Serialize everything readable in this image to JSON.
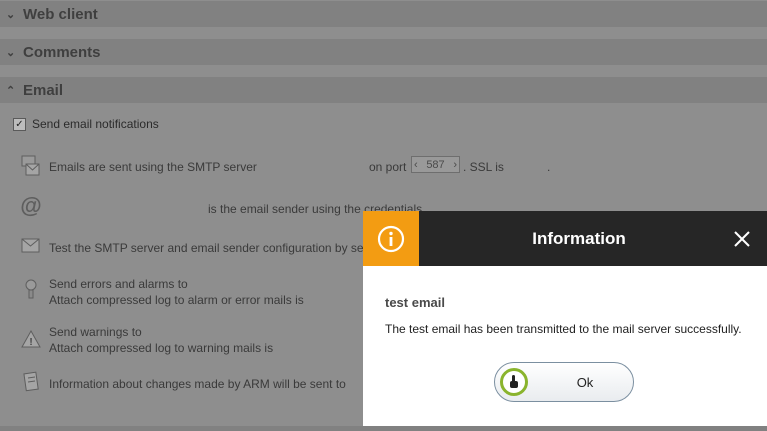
{
  "sections": [
    {
      "title": "Web client",
      "state": "collapsed"
    },
    {
      "title": "Comments",
      "state": "collapsed"
    },
    {
      "title": "Email",
      "state": "expanded"
    }
  ],
  "email": {
    "send_notifications_label": "Send email notifications",
    "send_notifications_checked": true,
    "smtp_text": "Emails are sent using the SMTP server",
    "on_port_text": "on port",
    "port_value": "587",
    "ssl_text": ". SSL is",
    "ssl_trailing": ".",
    "sender_text": "is the email sender using the credentials",
    "test_text": "Test the SMTP server and email sender configuration by sen",
    "errors_text": "Send errors and alarms to",
    "errors_attach_text": "Attach compressed log to alarm or error mails is",
    "warnings_text": "Send warnings to",
    "warnings_attach_text": "Attach compressed log to warning mails is",
    "changes_text": "Information about changes made by ARM will be sent to"
  },
  "dialog": {
    "title": "Information",
    "message_title": "test email",
    "message": "The test email has been transmitted to the mail server successfully.",
    "ok_label": "Ok",
    "accent_color": "#f39c12",
    "header_color": "#262626"
  }
}
